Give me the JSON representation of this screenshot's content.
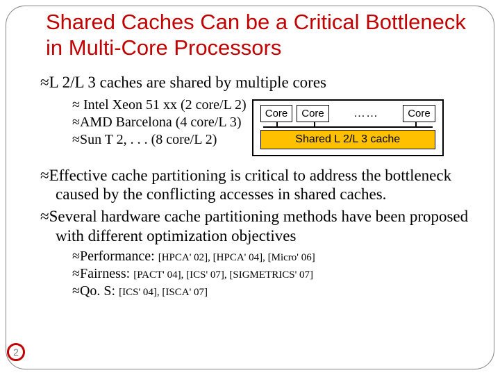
{
  "title": "Shared Caches Can be a Critical Bottleneck in Multi-Core Processors",
  "bullet_glyph": "≈",
  "p1": {
    "text": "L 2/L 3 caches are shared by multiple cores",
    "examples": [
      " Intel Xeon 51 xx (2 core/L 2)",
      "AMD Barcelona (4 core/L 3)",
      "Sun T 2, . . .          (8 core/L 2)"
    ]
  },
  "diagram": {
    "core_label": "Core",
    "ellipsis": "……",
    "cache_label": "Shared L 2/L 3 cache"
  },
  "p2": "Effective cache partitioning is critical to address the bottleneck caused by the conflicting accesses in shared caches.",
  "p3": "Several hardware cache partitioning methods have been proposed with different optimization objectives",
  "objectives": [
    {
      "label": "Performance: ",
      "refs": "[HPCA' 02], [HPCA' 04], [Micro' 06]"
    },
    {
      "label": "Fairness: ",
      "refs": "[PACT' 04], [ICS' 07], [SIGMETRICS' 07]"
    },
    {
      "label": "Qo. S: ",
      "refs": "[ICS' 04], [ISCA' 07]"
    }
  ],
  "page_number": "2"
}
